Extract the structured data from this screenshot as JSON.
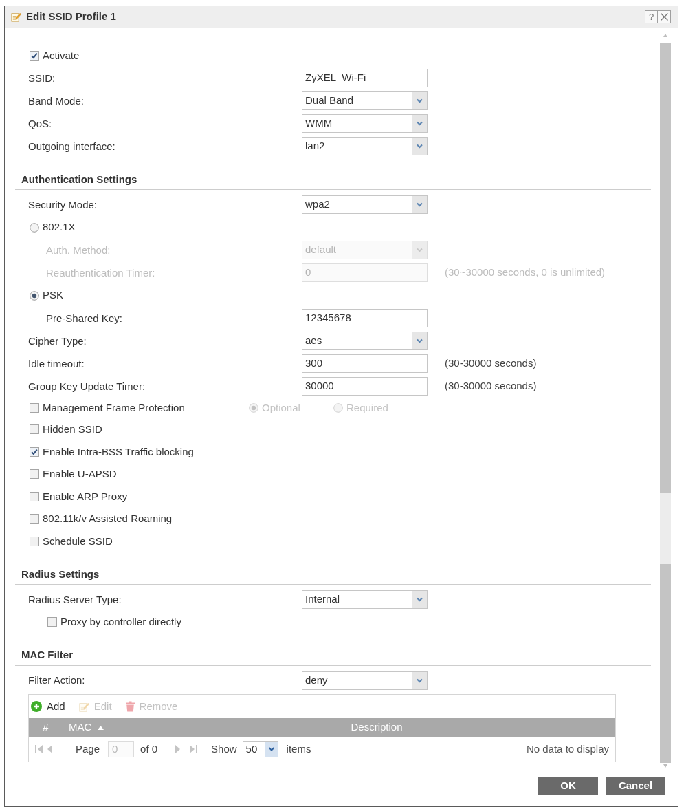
{
  "dialog": {
    "title": "Edit SSID Profile 1",
    "help": "?"
  },
  "sections": [
    {
      "rows": [
        {
          "kind": "checkbox",
          "label": "Activate",
          "checked": true
        },
        {
          "kind": "text",
          "label": "SSID:",
          "value": "ZyXEL_Wi-Fi"
        },
        {
          "kind": "select",
          "label": "Band Mode:",
          "value": "Dual Band"
        },
        {
          "kind": "select",
          "label": "QoS:",
          "value": "WMM"
        },
        {
          "kind": "select",
          "label": "Outgoing interface:",
          "value": "lan2"
        }
      ]
    },
    {
      "title": "Authentication Settings",
      "rows": [
        {
          "kind": "select",
          "label": "Security Mode:",
          "value": "wpa2"
        },
        {
          "kind": "radio",
          "label": "802.1X",
          "selected": false,
          "children": [
            {
              "kind": "select",
              "label": "Auth. Method:",
              "value": "default",
              "disabled": true
            },
            {
              "kind": "text",
              "label": "Reauthentication Timer:",
              "value": "0",
              "hint": "(30~30000 seconds, 0 is unlimited)",
              "disabled": true
            }
          ]
        },
        {
          "kind": "radio",
          "label": "PSK",
          "selected": true,
          "children": [
            {
              "kind": "text",
              "label": "Pre-Shared Key:",
              "value": "12345678",
              "disabled": false
            }
          ]
        },
        {
          "kind": "select",
          "label": "Cipher Type:",
          "value": "aes"
        },
        {
          "kind": "text",
          "label": "Idle timeout:",
          "value": "300",
          "hint": "(30-30000 seconds)"
        },
        {
          "kind": "text",
          "label": "Group Key Update Timer:",
          "value": "30000",
          "hint": "(30-30000 seconds)"
        },
        {
          "kind": "checkbox_options",
          "label": "Management Frame Protection",
          "checked": false,
          "options": [
            {
              "label": "Optional",
              "selected": true,
              "disabled": true
            },
            {
              "label": "Required",
              "selected": false,
              "disabled": true
            }
          ]
        },
        {
          "kind": "checkbox",
          "label": "Hidden SSID",
          "checked": false
        },
        {
          "kind": "checkbox",
          "label": "Enable Intra-BSS Traffic blocking",
          "checked": true
        },
        {
          "kind": "checkbox",
          "label": "Enable U-APSD",
          "checked": false
        },
        {
          "kind": "checkbox",
          "label": "Enable ARP Proxy",
          "checked": false
        },
        {
          "kind": "checkbox",
          "label": "802.11k/v Assisted Roaming",
          "checked": false
        },
        {
          "kind": "checkbox",
          "label": "Schedule SSID",
          "checked": false
        }
      ]
    },
    {
      "title": "Radius Settings",
      "rows": [
        {
          "kind": "select",
          "label": "Radius Server Type:",
          "value": "Internal",
          "children": [
            {
              "kind": "checkbox",
              "label": "Proxy by controller directly",
              "checked": false
            }
          ]
        }
      ]
    },
    {
      "title": "MAC Filter",
      "rows": [
        {
          "kind": "select",
          "label": "Filter Action:",
          "value": "deny"
        }
      ],
      "table": {
        "toolbar": [
          {
            "kind": "add",
            "label": "Add",
            "disabled": false
          },
          {
            "kind": "edit",
            "label": "Edit",
            "disabled": true
          },
          {
            "kind": "remove",
            "label": "Remove",
            "disabled": true
          }
        ],
        "columns": [
          {
            "label": "#",
            "sorted": false
          },
          {
            "label": "MAC",
            "sorted": true
          },
          {
            "label": "Description",
            "sorted": false
          }
        ],
        "pager": {
          "page_label": "Page",
          "page": "0",
          "of_label": "of 0",
          "show_label": "Show",
          "page_size": "50",
          "items_label": "items",
          "status": "No data to display"
        }
      }
    }
  ],
  "buttons": [
    {
      "label": "OK"
    },
    {
      "label": "Cancel"
    }
  ]
}
